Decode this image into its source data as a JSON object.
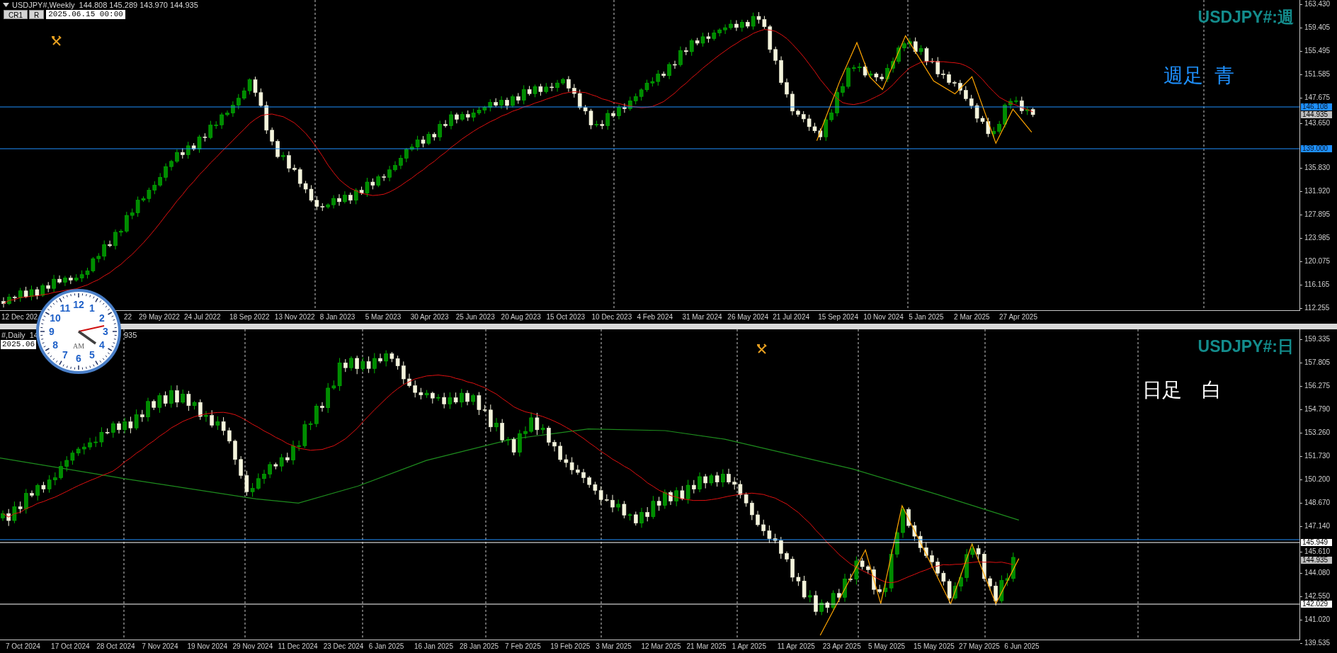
{
  "top_chart": {
    "header": {
      "symbol_line": "USDJPY#,Weekly  144.808 145.289 143.970 144.935",
      "buttons": [
        {
          "label": "CR1"
        },
        {
          "label": "R"
        }
      ],
      "datetime": "2025.06.15 00:00"
    },
    "title": "USDJPY#:週",
    "note": "週足  青",
    "price_axis": [
      "163.430",
      "159.405",
      "155.495",
      "151.585",
      "147.675",
      "143.650",
      "135.830",
      "131.920",
      "127.895",
      "123.985",
      "120.075",
      "116.165",
      "112.255"
    ],
    "price_tags": [
      {
        "text": "146.108",
        "kind": "blue"
      },
      {
        "text": "144.935",
        "kind": "bid"
      },
      {
        "text": "139.000",
        "kind": "blue"
      }
    ],
    "time_axis": [
      "12 Dec 202",
      "22",
      "29 May 2022",
      "24 Jul 2022",
      "18 Sep 2022",
      "13 Nov 2022",
      "8 Jan 2023",
      "5 Mar 2023",
      "30 Apr 2023",
      "25 Jun 2023",
      "20 Aug 2023",
      "15 Oct 2023",
      "10 Dec 2023",
      "4 Feb 2024",
      "31 Mar 2024",
      "26 May 2024",
      "21 Jul 2024",
      "15 Sep 2024",
      "10 Nov 2024",
      "5 Jan 2025",
      "2 Mar 2025",
      "27 Apr 2025"
    ]
  },
  "bottom_chart": {
    "header": {
      "symbol_fragments": [
        "#,Daily  14",
        "935"
      ],
      "datetime": "2025.06"
    },
    "title": "USDJPY#:日",
    "note": "日足　白",
    "price_axis": [
      "159.335",
      "157.805",
      "156.275",
      "154.790",
      "153.260",
      "151.730",
      "150.200",
      "148.670",
      "147.140",
      "145.610",
      "144.080",
      "142.550",
      "141.020",
      "139.535"
    ],
    "price_tags": [
      {
        "text": "145.949",
        "kind": "white"
      },
      {
        "text": "144.935",
        "kind": "bid"
      },
      {
        "text": "142.029",
        "kind": "white"
      }
    ],
    "time_axis": [
      "7 Oct 2024",
      "17 Oct 2024",
      "28 Oct 2024",
      "7 Nov 2024",
      "19 Nov 2024",
      "29 Nov 2024",
      "11 Dec 2024",
      "23 Dec 2024",
      "6 Jan 2025",
      "16 Jan 2025",
      "28 Jan 2025",
      "7 Feb 2025",
      "19 Feb 2025",
      "3 Mar 2025",
      "12 Mar 2025",
      "21 Mar 2025",
      "1 Apr 2025",
      "11 Apr 2025",
      "23 Apr 2025",
      "5 May 2025",
      "15 May 2025",
      "27 May 2025",
      "6 Jun 2025"
    ]
  },
  "clock": {
    "numerals": [
      "12",
      "11",
      "1",
      "10",
      "2",
      "9",
      "3",
      "8",
      "4",
      "7",
      "5",
      "6"
    ],
    "period": "AM"
  }
}
